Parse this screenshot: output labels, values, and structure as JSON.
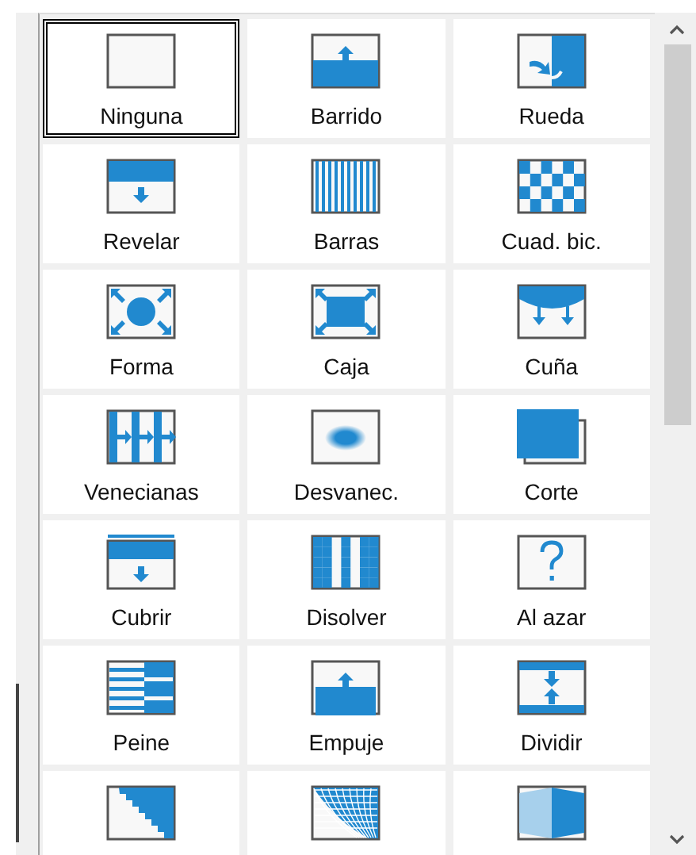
{
  "transitions": [
    {
      "label": "Ninguna",
      "selected": true
    },
    {
      "label": "Barrido",
      "selected": false
    },
    {
      "label": "Rueda",
      "selected": false
    },
    {
      "label": "Revelar",
      "selected": false
    },
    {
      "label": "Barras",
      "selected": false
    },
    {
      "label": "Cuad. bic.",
      "selected": false
    },
    {
      "label": "Forma",
      "selected": false
    },
    {
      "label": "Caja",
      "selected": false
    },
    {
      "label": "Cuña",
      "selected": false
    },
    {
      "label": "Venecianas",
      "selected": false
    },
    {
      "label": "Desvanec.",
      "selected": false
    },
    {
      "label": "Corte",
      "selected": false
    },
    {
      "label": "Cubrir",
      "selected": false
    },
    {
      "label": "Disolver",
      "selected": false
    },
    {
      "label": "Al azar",
      "selected": false
    },
    {
      "label": "Peine",
      "selected": false
    },
    {
      "label": "Empuje",
      "selected": false
    },
    {
      "label": "Dividir",
      "selected": false
    },
    {
      "selected": false
    },
    {
      "selected": false
    },
    {
      "selected": false
    }
  ]
}
